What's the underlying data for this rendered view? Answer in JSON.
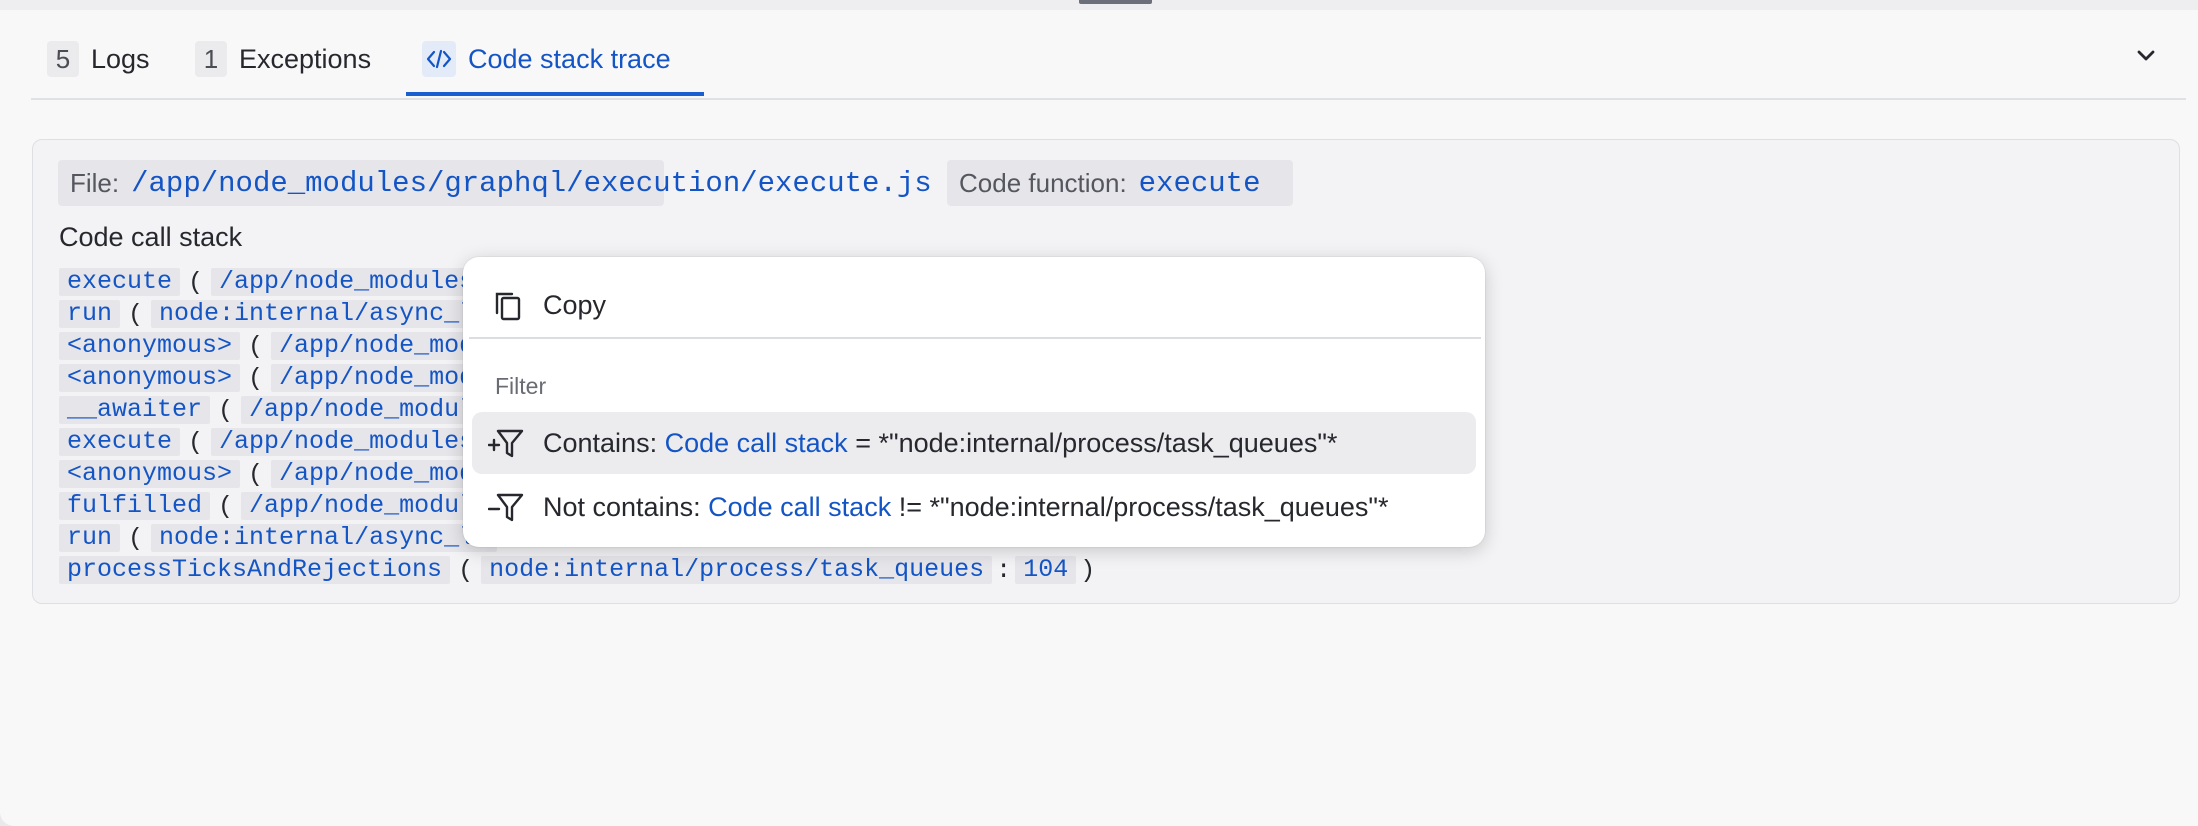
{
  "tabs": [
    {
      "count": "5",
      "label": "Logs"
    },
    {
      "count": "1",
      "label": "Exceptions"
    },
    {
      "label": "Code stack trace",
      "icon": "code-icon"
    }
  ],
  "details": {
    "file_key": "File:",
    "file_value": "/app/node_modules/graphql/execution/execute.js",
    "function_key": "Code function:",
    "function_value": "execute"
  },
  "stack": {
    "title": "Code call stack",
    "frames": [
      {
        "fn": "execute",
        "path": "/app/node_modules,"
      },
      {
        "fn": "run",
        "path": "node:internal/async_lo"
      },
      {
        "fn": "<anonymous>",
        "path": "/app/node_modu"
      },
      {
        "fn": "<anonymous>",
        "path": "/app/node_modu"
      },
      {
        "fn": "__awaiter",
        "path": "/app/node_module"
      },
      {
        "fn": "execute",
        "path": "/app/node_modules,"
      },
      {
        "fn": "<anonymous>",
        "path": "/app/node_modu"
      },
      {
        "fn": "fulfilled",
        "path": "/app/node_module"
      },
      {
        "fn": "run",
        "path": "node:internal/async_lo"
      },
      {
        "fn": "processTicksAndRejections",
        "path": "node:internal/process/task_queues",
        "line": "104"
      }
    ]
  },
  "context_menu": {
    "copy_label": "Copy",
    "section_label": "Filter",
    "contains": {
      "prefix": "Contains:",
      "field": "Code call stack",
      "expr": "= *\"node:internal/process/task_queues\"*"
    },
    "not_contains": {
      "prefix": "Not contains:",
      "field": "Code call stack",
      "expr": "!= *\"node:internal/process/task_queues\"*"
    }
  },
  "colors": {
    "accent": "#1455c6",
    "background": "#f8f8f9",
    "menu_hover": "#ececef"
  }
}
